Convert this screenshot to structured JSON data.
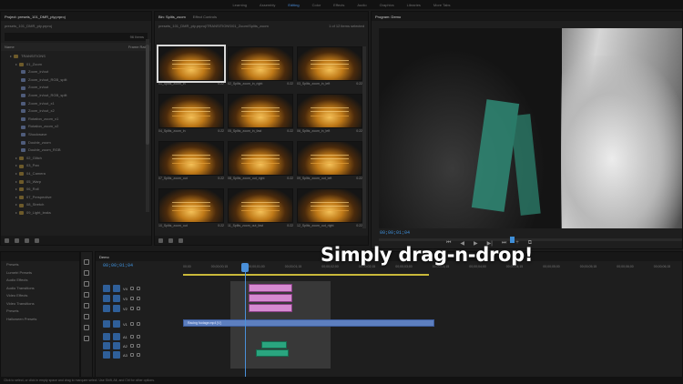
{
  "topbar": {
    "workspaces": [
      "Learning",
      "Assembly",
      "Editing",
      "Color",
      "Effects",
      "Audio",
      "Graphics",
      "Libraries",
      "More Tabs"
    ],
    "active": "Editing"
  },
  "project_panel": {
    "tab": "Project: presets_101_DMR_pty.prproj",
    "path": "presets_101_DMR_pty.prproj",
    "item_count": "96 Items",
    "name_header": "Name",
    "rate_header": "Frame Rate",
    "tree": [
      {
        "label": "TRANSITIONS",
        "type": "folder",
        "indent": 1
      },
      {
        "label": "01_Zoom",
        "type": "folder",
        "indent": 2
      },
      {
        "label": "Zoom_in/out",
        "type": "item",
        "indent": 3
      },
      {
        "label": "Zoom_in/out_RGB_split",
        "type": "item",
        "indent": 3
      },
      {
        "label": "Zoom_in/out",
        "type": "item",
        "indent": 3
      },
      {
        "label": "Zoom_in/out_RGB_split",
        "type": "item",
        "indent": 3
      },
      {
        "label": "Zoom_in/out_x1",
        "type": "item",
        "indent": 3
      },
      {
        "label": "Zoom_in/out_x2",
        "type": "item",
        "indent": 3
      },
      {
        "label": "Rotation_zoom_x1",
        "type": "item",
        "indent": 3
      },
      {
        "label": "Rotation_zoom_x2",
        "type": "item",
        "indent": 3
      },
      {
        "label": "Shockwave",
        "type": "item",
        "indent": 3
      },
      {
        "label": "Double_zoom",
        "type": "item",
        "indent": 3
      },
      {
        "label": "Double_zoom_RGB",
        "type": "item",
        "indent": 3
      },
      {
        "label": "02_Glitch",
        "type": "folder",
        "indent": 2
      },
      {
        "label": "03_Pan",
        "type": "folder",
        "indent": 2
      },
      {
        "label": "04_Camera",
        "type": "folder",
        "indent": 2
      },
      {
        "label": "05_Warp",
        "type": "folder",
        "indent": 2
      },
      {
        "label": "06_Roll",
        "type": "folder",
        "indent": 2
      },
      {
        "label": "07_Perspective",
        "type": "folder",
        "indent": 2
      },
      {
        "label": "08_Stretch",
        "type": "folder",
        "indent": 2
      },
      {
        "label": "09_Light_leaks",
        "type": "folder",
        "indent": 2
      }
    ]
  },
  "bin_panel": {
    "tabs": [
      "Bin: Splits_zoom",
      "Effect Controls"
    ],
    "path": "presets_101_DMR_pty.prproj\\TRANSITIONS\\01_Zoom\\Splits_zoom",
    "selection": "1 of 12 items selected",
    "clips": [
      {
        "name": "01_Splits_zoom_in",
        "dur": "0:22"
      },
      {
        "name": "02_Splits_zoom_in_right",
        "dur": "0:22"
      },
      {
        "name": "03_Splits_zoom_in_left",
        "dur": "0:22"
      },
      {
        "name": "04_Splits_zoom_in",
        "dur": "0:22"
      },
      {
        "name": "05_Splits_zoom_in_fast",
        "dur": "0:22"
      },
      {
        "name": "06_Splits_zoom_in_left",
        "dur": "0:22"
      },
      {
        "name": "07_Splits_zoom_out",
        "dur": "0:22"
      },
      {
        "name": "08_Splits_zoom_out_right",
        "dur": "0:22"
      },
      {
        "name": "09_Splits_zoom_out_left",
        "dur": "0:22"
      },
      {
        "name": "10_Splits_zoom_out",
        "dur": "0:22"
      },
      {
        "name": "11_Splits_zoom_out_fast",
        "dur": "0:22"
      },
      {
        "name": "12_Splits_zoom_out_right",
        "dur": "0:22"
      }
    ]
  },
  "program_monitor": {
    "tab": "Program: Demo",
    "timecode": "00;00;01;04"
  },
  "transport": [
    "⏮",
    "◀",
    "▶",
    "▶|",
    "⏭",
    "+",
    "⧉"
  ],
  "effects_list": [
    "Presets",
    "Lumetri Presets",
    "Audio Effects",
    "Audio Transitions",
    "Video Effects",
    "Video Transitions",
    "Presets",
    "Halloween Presets"
  ],
  "timeline": {
    "tab": "Demo",
    "timecode": "00;00;01;04",
    "ruler": [
      "00;00",
      "00;00;00;15",
      "00;00;01;00",
      "00;00;01;15",
      "00;00;02;00",
      "00;00;02;15",
      "00;00;03;00",
      "00;00;03;15",
      "00;00;04;00",
      "00;00;04;15",
      "00;00;05;00",
      "00;00;05;15",
      "00;00;06;00",
      "00;00;06;15",
      "00;00;07;00",
      "00;00;07;15",
      "00;00;08;00"
    ],
    "tracks": [
      "V4",
      "V3",
      "V2",
      "V1",
      "A1",
      "A2",
      "A3"
    ],
    "v1_clip": "Racing footage.mp4 [V]"
  },
  "status_bar": "Click to select, or click in empty space and drag to marquee select. Use Shift, Alt, and Ctrl for other options.",
  "caption": "Simply drag-n-drop!",
  "colors": {
    "accent": "#3f8fd9",
    "clip_video": "#d58ad0",
    "clip_audio": "#2aa57f",
    "v1_clip": "#5d7fbf"
  }
}
